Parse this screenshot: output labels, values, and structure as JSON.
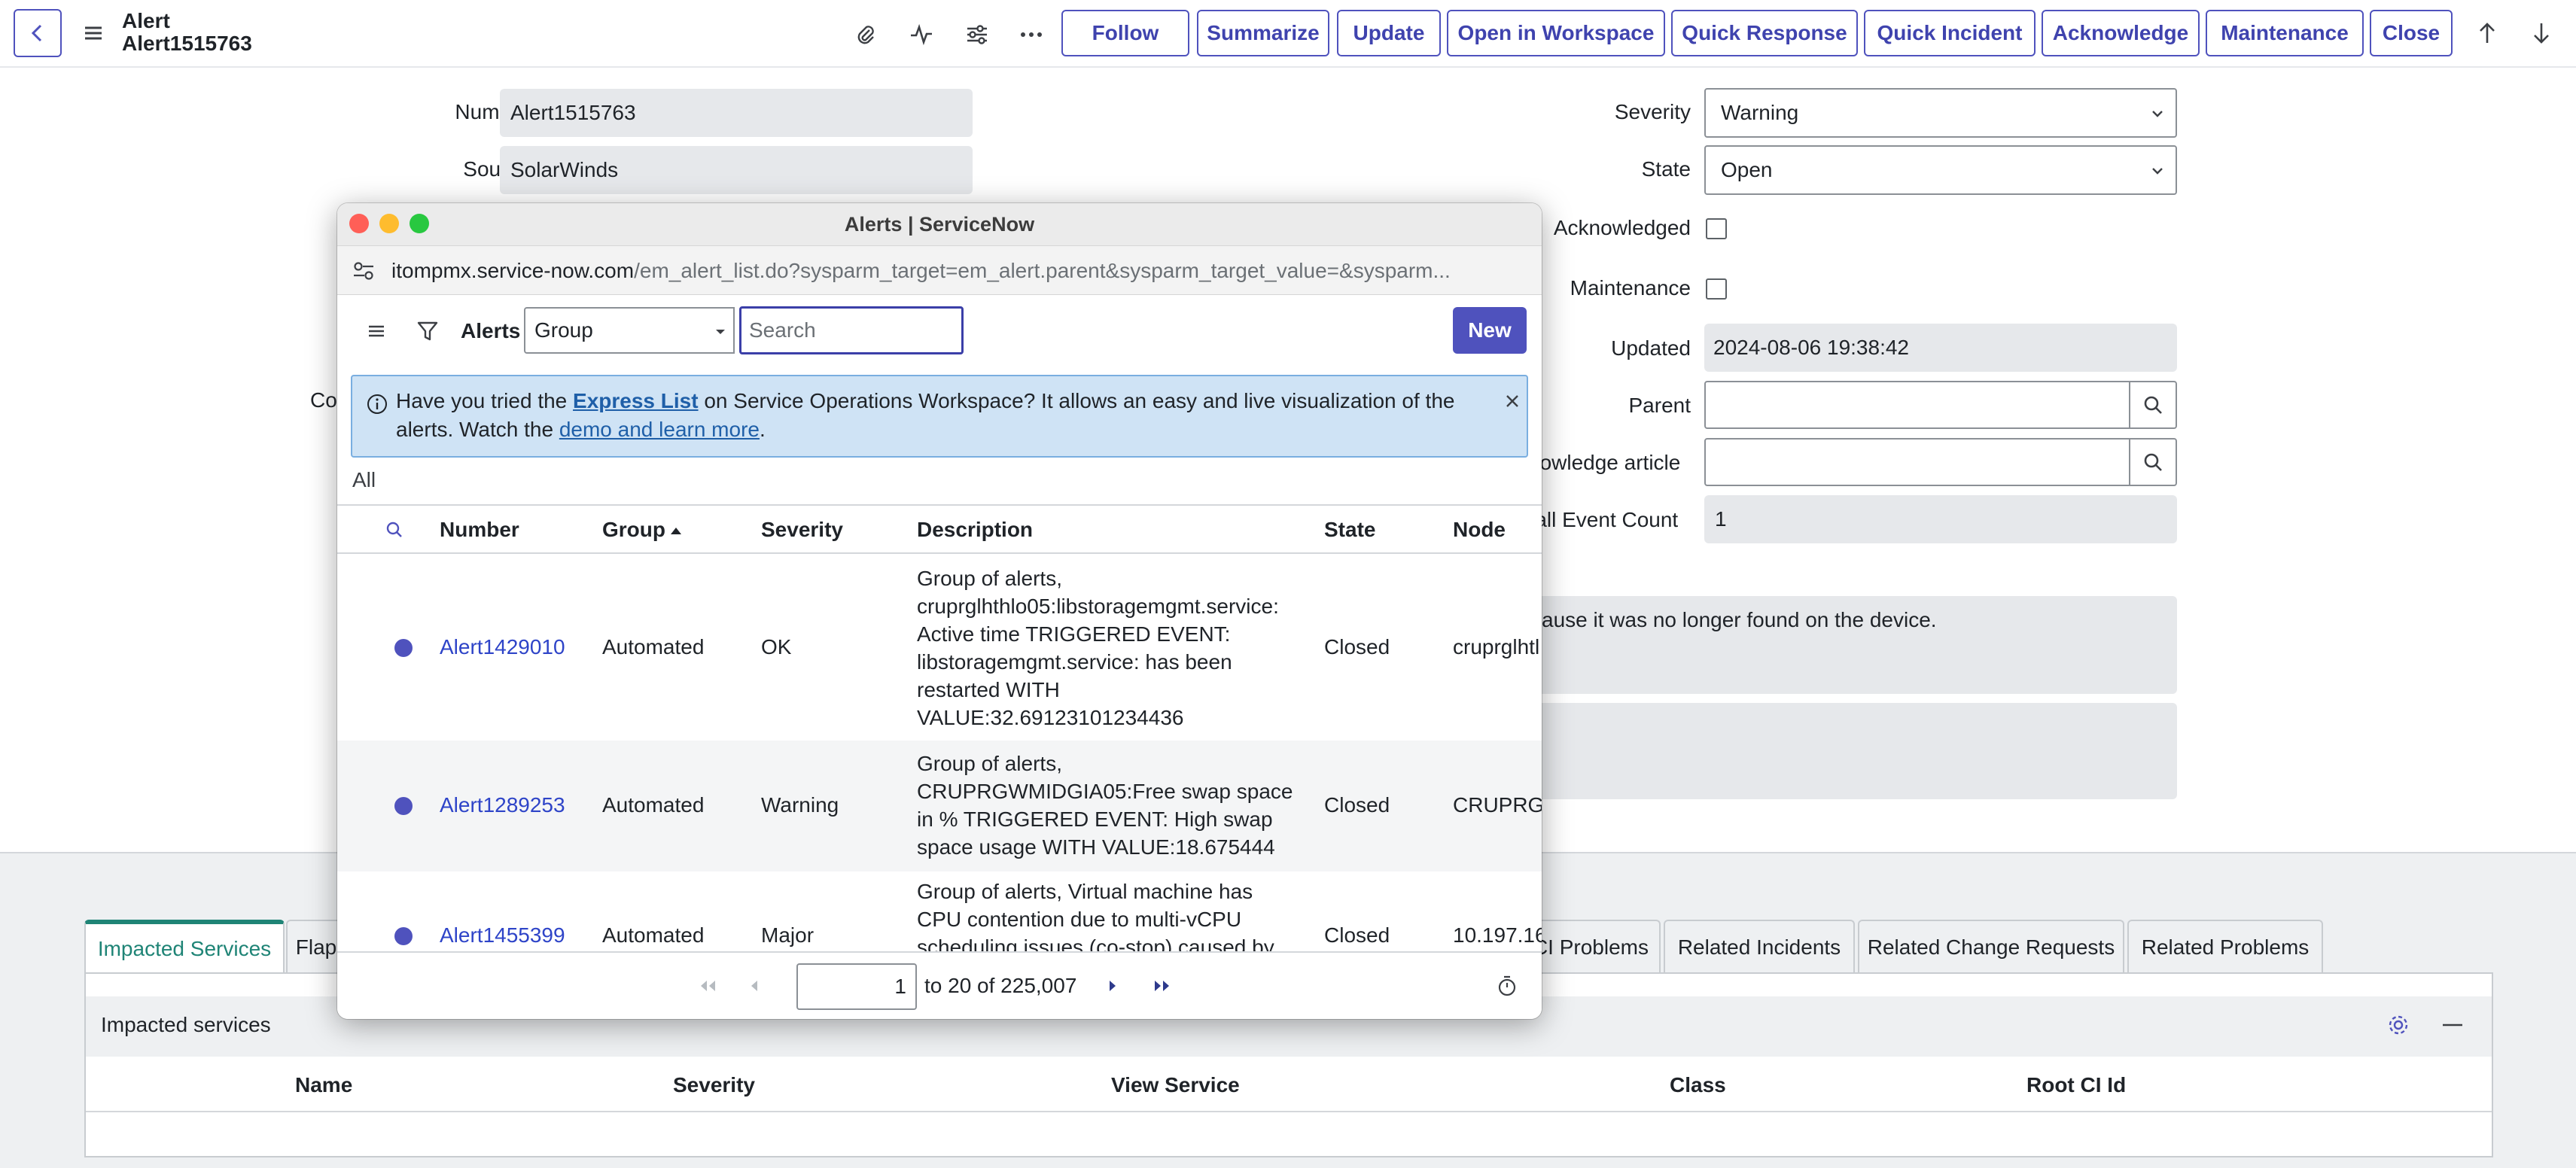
{
  "header": {
    "record_type": "Alert",
    "record_number": "Alert1515763",
    "buttons": [
      "Follow",
      "Summarize",
      "Update",
      "Open in Workspace",
      "Quick Response",
      "Quick Incident",
      "Acknowledge",
      "Maintenance",
      "Close"
    ]
  },
  "form": {
    "number_label": "Number",
    "number_value": "Alert1515763",
    "source_label": "Source",
    "source_value": "SolarWinds",
    "co_label_fragment": "Co",
    "severity_label": "Severity",
    "severity_value": "Warning",
    "state_label": "State",
    "state_value": "Open",
    "acknowledged_label": "Acknowledged",
    "maintenance_label": "Maintenance",
    "updated_label": "Updated",
    "updated_value": "2024-08-06 19:38:42",
    "parent_label": "Parent",
    "knowledge_label": "nowledge article",
    "event_count_label": "rall Event Count",
    "event_count_value": "1",
    "description_fragment": "cause it was no longer found on the device."
  },
  "related": {
    "tabs": [
      "Impacted Services",
      "Flap",
      "CI Problems",
      "Related Incidents",
      "Related Change Requests",
      "Related Problems"
    ],
    "panel_title": "Impacted services",
    "columns": [
      "Name",
      "Severity",
      "View Service",
      "Class",
      "Root CI Id"
    ]
  },
  "popup": {
    "window_title": "Alerts | ServiceNow",
    "url_domain": "itompmx.service-now.com",
    "url_path": "/em_alert_list.do?sysparm_target=em_alert.parent&sysparm_target_value=&sysparm...",
    "list_title": "Alerts",
    "group_select": "Group",
    "search_placeholder": "Search",
    "new_button": "New",
    "info": {
      "part1": "Have you tried the ",
      "link1": "Express List",
      "part2": " on Service Operations Workspace? It allows an easy and live visualization of the alerts. Watch the ",
      "link2": "demo and learn more",
      "part3": "."
    },
    "breadcrumb": "All",
    "columns": [
      "Number",
      "Group",
      "Severity",
      "Description",
      "State",
      "Node"
    ],
    "rows": [
      {
        "number": "Alert1429010",
        "group": "Automated",
        "severity": "OK",
        "description": "Group of alerts, cruprglhthlo05:libstoragemgmt.service: Active time TRIGGERED EVENT: libstoragemgmt.service: has been restarted WITH VALUE:32.69123101234436",
        "state": "Closed",
        "node": "cruprglhtl"
      },
      {
        "number": "Alert1289253",
        "group": "Automated",
        "severity": "Warning",
        "description": "Group of alerts, CRUPRGWMIDGIA05:Free swap space in % TRIGGERED EVENT: High swap space usage WITH VALUE:18.675444",
        "state": "Closed",
        "node": "CRUPRGW"
      },
      {
        "number": "Alert1455399",
        "group": "Automated",
        "severity": "Major",
        "description": "Group of alerts, Virtual machine has CPU contention due to multi-vCPU scheduling issues (co-stop) caused by too",
        "state": "Closed",
        "node": "10.197.16"
      }
    ],
    "pager": {
      "current_page": "1",
      "range_text": "to 20 of 225,007"
    }
  },
  "colors": {
    "brand": "#4f52bd",
    "active_tab": "#1f8476",
    "info_bg": "#cfe3f5",
    "mac_close": "#ff5f57",
    "mac_min": "#febc2e",
    "mac_max": "#28c840"
  }
}
